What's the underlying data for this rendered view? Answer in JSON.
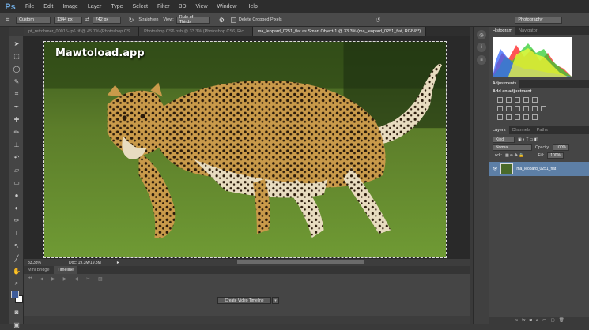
{
  "app": {
    "logo": "Ps"
  },
  "menu": [
    "File",
    "Edit",
    "Image",
    "Layer",
    "Type",
    "Select",
    "Filter",
    "3D",
    "View",
    "Window",
    "Help"
  ],
  "options": {
    "ratio": "Custom",
    "width": "1344 px",
    "height": "742 px",
    "swap_icon": "swap-icon",
    "straighten": "Straighten",
    "view_label": "View:",
    "view_value": "Rule of Thirds",
    "delete_cropped": "Delete Cropped Pixels",
    "workspace": "Photography"
  },
  "tabs": [
    {
      "label": "pt_retrohmer_00015-rp6.tif @ 45.7% (Photoshop CS..."
    },
    {
      "label": "Photoshop CS6.psb @ 33.3% (Photoshop CS6, Ric..."
    },
    {
      "label": "ma_leopard_0251_flat as Smart Object-1 @ 33.3% (ma_leopard_0251_flat, RGB/8*)"
    }
  ],
  "canvas": {
    "watermark": "Mawtoload.app"
  },
  "status": {
    "zoom": "33.33%",
    "doc": "Doc: 19.3M/19.3M"
  },
  "timeline": {
    "tabs": [
      "Mini Bridge",
      "Timeline"
    ],
    "create_button": "Create Video Timeline"
  },
  "panels": {
    "histogram_tabs": [
      "Histogram",
      "Navigator"
    ],
    "adjustments_tab": "Adjustments",
    "add_adjustment": "Add an adjustment",
    "layers_tabs": [
      "Layers",
      "Channels",
      "Paths"
    ],
    "kind": "Kind",
    "blend": "Normal",
    "opacity_label": "Opacity:",
    "opacity": "100%",
    "lock_label": "Lock:",
    "fill_label": "Fill:",
    "fill": "100%",
    "layer_name": "ma_leopard_0251_flat"
  },
  "colors": {
    "fg": "#3e5c9a",
    "bg": "#ffffff",
    "accent": "#5d7fa6"
  }
}
